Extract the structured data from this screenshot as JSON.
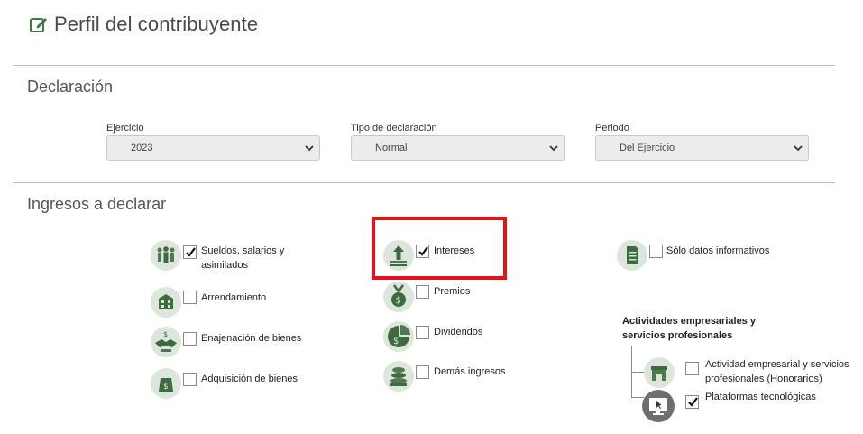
{
  "page": {
    "title": "Perfil del contribuyente"
  },
  "declaracion": {
    "title": "Declaración",
    "fields": [
      {
        "label": "Ejercicio",
        "value": "2023"
      },
      {
        "label": "Tipo de declaración",
        "value": "Normal"
      },
      {
        "label": "Periodo",
        "value": "Del Ejercicio"
      }
    ]
  },
  "ingresos": {
    "title": "Ingresos a declarar",
    "col1": [
      {
        "label": "Sueldos, salarios y asimilados",
        "checked": true
      },
      {
        "label": "Arrendamiento",
        "checked": false
      },
      {
        "label": "Enajenación de bienes",
        "checked": false
      },
      {
        "label": "Adquisición de bienes",
        "checked": false
      }
    ],
    "col2": [
      {
        "label": "Intereses",
        "checked": true
      },
      {
        "label": "Premios",
        "checked": false
      },
      {
        "label": "Dividendos",
        "checked": false
      },
      {
        "label": "Demás ingresos",
        "checked": false
      }
    ],
    "col3": {
      "informativos": {
        "label": "Sólo datos informativos",
        "checked": false
      },
      "group_title": "Actividades empresariales y servicios profesionales",
      "sub": [
        {
          "label": "Actividad empresarial y servicios profesionales (Honorarios)",
          "checked": false
        },
        {
          "label": "Plataformas tecnológicas",
          "checked": true
        }
      ]
    }
  },
  "colors": {
    "accent_green": "#3d6b3d",
    "highlight_red": "#e0141c",
    "icon_bg": "#dde6dd"
  }
}
